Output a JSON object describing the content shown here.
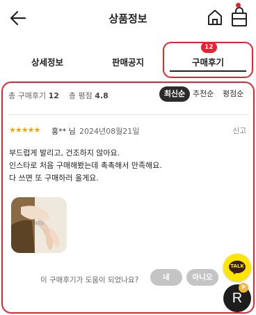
{
  "header": {
    "title": "상품정보",
    "back_icon": "back-arrow-icon",
    "home_icon": "home-icon",
    "cart_icon": "shopping-bag-icon",
    "cart_dot_color": "#e8232f"
  },
  "tabs": [
    {
      "label": "상세정보",
      "active": false
    },
    {
      "label": "판매공지",
      "active": false
    },
    {
      "label": "구매후기",
      "active": true,
      "badge": "12"
    }
  ],
  "summary": {
    "total_label": "총 구매후기",
    "total_count": "12",
    "rating_label": "총 평점",
    "rating_value": "4.8"
  },
  "sort_options": [
    {
      "label": "최신순",
      "selected": true
    },
    {
      "label": "추천순",
      "selected": false
    },
    {
      "label": "평점순",
      "selected": false
    }
  ],
  "review": {
    "stars": "★★★★★",
    "rating": 5,
    "author": "홍** 님",
    "date": "2024년08월21일",
    "report_label": "신고",
    "lines": [
      "부드럽게 발리고, 건조하지 않아요.",
      "인스타로 처음 구매해봤는데 촉촉해서 만족해요.",
      "다 쓰면 또 구매하러 올게요."
    ],
    "helpful_question": "이 구매후기가 도움이 되었나요?",
    "yes_label": "네",
    "no_label": "아니오"
  },
  "floating": {
    "kakao_label": "TALK",
    "r_label": "R",
    "r_coin": "P"
  },
  "colors": {
    "accent": "#e8232f",
    "star": "#f4a600",
    "kakao": "#fee500"
  }
}
